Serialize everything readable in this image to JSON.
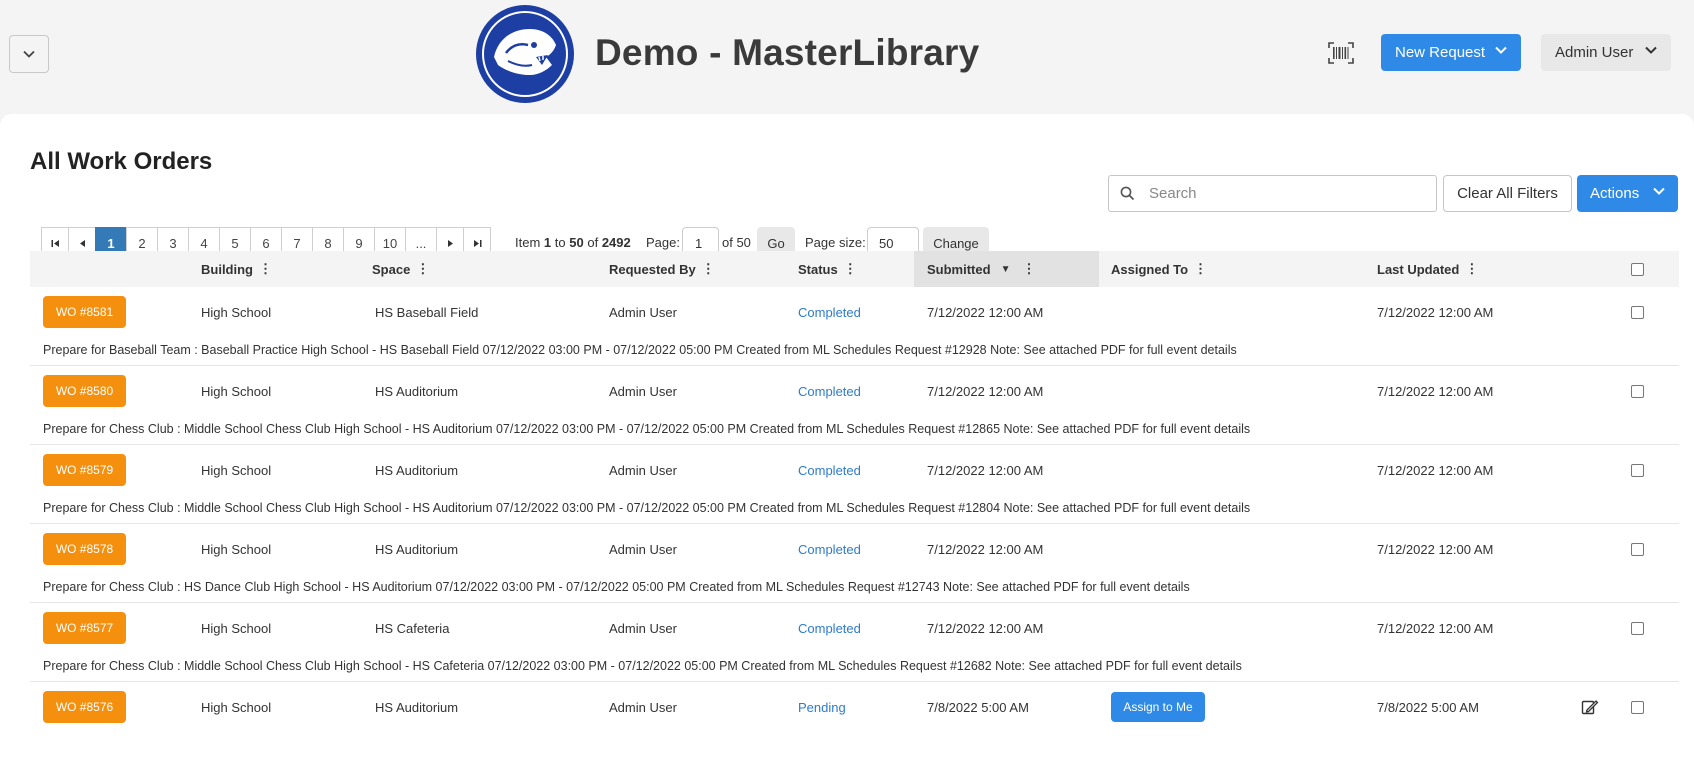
{
  "header": {
    "title": "Demo - MasterLibrary",
    "new_request_label": "New Request",
    "user_label": "Admin User"
  },
  "page": {
    "title": "All Work Orders",
    "search_placeholder": "Search",
    "clear_filters_label": "Clear All Filters",
    "actions_label": "Actions"
  },
  "pager": {
    "pages": [
      "1",
      "2",
      "3",
      "4",
      "5",
      "6",
      "7",
      "8",
      "9",
      "10"
    ],
    "active_page": "1",
    "ellipsis": "...",
    "item_prefix": "Item",
    "item_from": "1",
    "item_to_word": "to",
    "item_to": "50",
    "item_of_word": "of",
    "item_total": "2492",
    "page_label": "Page:",
    "page_value": "1",
    "of_pages": "of 50",
    "go_label": "Go",
    "page_size_label": "Page size:",
    "page_size_value": "50",
    "change_label": "Change"
  },
  "columns": {
    "building": "Building",
    "space": "Space",
    "requested_by": "Requested By",
    "status": "Status",
    "submitted": "Submitted",
    "assigned_to": "Assigned To",
    "last_updated": "Last Updated"
  },
  "colors": {
    "accent_blue": "#2e8ae6",
    "wo_orange": "#f5900f",
    "status_blue": "#2e7bcf",
    "pager_active": "#337ab7",
    "logo_blue": "#1d3fa3"
  },
  "rows": [
    {
      "wo": "WO #8581",
      "building": "High School",
      "space": "HS Baseball Field",
      "requested_by": "Admin User",
      "status": "Completed",
      "submitted": "7/12/2022 12:00 AM",
      "assigned_to": "",
      "last_updated": "7/12/2022 12:00 AM",
      "description": "Prepare for Baseball Team : Baseball Practice High School - HS Baseball Field 07/12/2022 03:00 PM - 07/12/2022 05:00 PM Created from ML Schedules Request #12928 Note: See attached PDF for full event details"
    },
    {
      "wo": "WO #8580",
      "building": "High School",
      "space": "HS Auditorium",
      "requested_by": "Admin User",
      "status": "Completed",
      "submitted": "7/12/2022 12:00 AM",
      "assigned_to": "",
      "last_updated": "7/12/2022 12:00 AM",
      "description": "Prepare for Chess Club : Middle School Chess Club High School - HS Auditorium 07/12/2022 03:00 PM - 07/12/2022 05:00 PM Created from ML Schedules Request #12865 Note: See attached PDF for full event details"
    },
    {
      "wo": "WO #8579",
      "building": "High School",
      "space": "HS Auditorium",
      "requested_by": "Admin User",
      "status": "Completed",
      "submitted": "7/12/2022 12:00 AM",
      "assigned_to": "",
      "last_updated": "7/12/2022 12:00 AM",
      "description": "Prepare for Chess Club : Middle School Chess Club High School - HS Auditorium 07/12/2022 03:00 PM - 07/12/2022 05:00 PM Created from ML Schedules Request #12804 Note: See attached PDF for full event details"
    },
    {
      "wo": "WO #8578",
      "building": "High School",
      "space": "HS Auditorium",
      "requested_by": "Admin User",
      "status": "Completed",
      "submitted": "7/12/2022 12:00 AM",
      "assigned_to": "",
      "last_updated": "7/12/2022 12:00 AM",
      "description": "Prepare for Chess Club : HS Dance Club High School - HS Auditorium 07/12/2022 03:00 PM - 07/12/2022 05:00 PM Created from ML Schedules Request #12743 Note: See attached PDF for full event details"
    },
    {
      "wo": "WO #8577",
      "building": "High School",
      "space": "HS Cafeteria",
      "requested_by": "Admin User",
      "status": "Completed",
      "submitted": "7/12/2022 12:00 AM",
      "assigned_to": "",
      "last_updated": "7/12/2022 12:00 AM",
      "description": "Prepare for Chess Club : Middle School Chess Club High School - HS Cafeteria 07/12/2022 03:00 PM - 07/12/2022 05:00 PM Created from ML Schedules Request #12682 Note: See attached PDF for full event details"
    },
    {
      "wo": "WO #8576",
      "building": "High School",
      "space": "HS Auditorium",
      "requested_by": "Admin User",
      "status": "Pending",
      "submitted": "7/8/2022 5:00 AM",
      "assign_button": "Assign to Me",
      "last_updated": "7/8/2022 5:00 AM",
      "description": ""
    }
  ]
}
